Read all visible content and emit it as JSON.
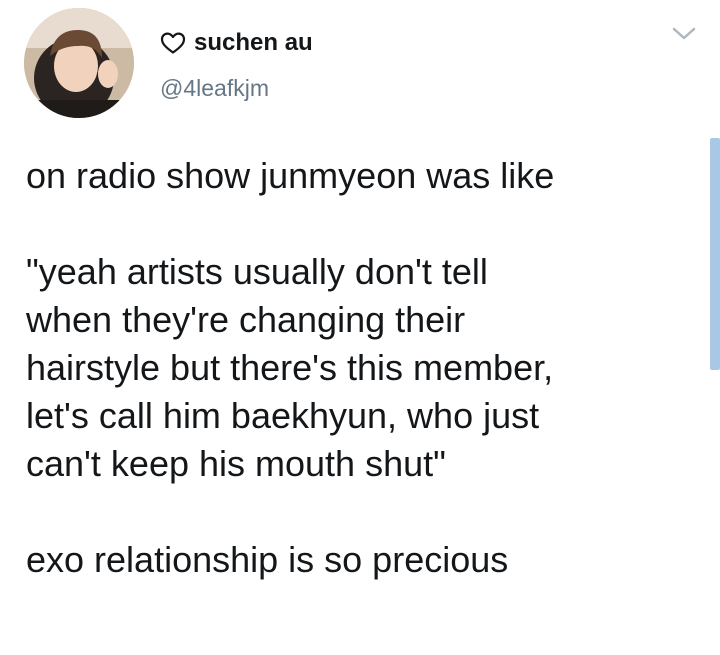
{
  "tweet": {
    "display_name": "suchen au",
    "handle": "@4leafkjm",
    "paragraphs": [
      "on radio show junmyeon was like",
      "\"yeah artists usually don't tell\nwhen they're changing their\nhairstyle but there's this member,\nlet's call him baekhyun, who just\ncan't keep his mouth shut\"",
      "exo relationship is so precious"
    ]
  },
  "icons": {
    "name_prefix": "heart-outline-icon",
    "menu": "chevron-down-icon",
    "avatar": "user-avatar-photo"
  },
  "colors": {
    "text_primary": "#14171a",
    "text_secondary": "#657786",
    "scroll_indicator": "#a8c8e6"
  }
}
